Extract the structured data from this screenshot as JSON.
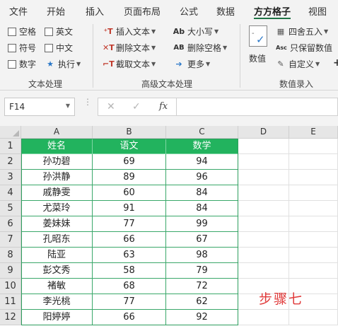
{
  "menu": {
    "tabs": [
      "文件",
      "开始",
      "插入",
      "页面布局",
      "公式",
      "数据",
      "方方格子",
      "视图"
    ],
    "active_index": 6
  },
  "ribbon": {
    "text_group": {
      "label": "文本处理",
      "checkboxes": [
        "空格",
        "英文",
        "符号",
        "中文",
        "数字"
      ],
      "execute_label": "执行"
    },
    "advanced_group": {
      "label": "高级文本处理",
      "insert_text": "插入文本",
      "delete_text": "删除文本",
      "extract_text": "截取文本",
      "case_label": "大小写",
      "case_icon_text": "Ab",
      "delete_spaces": "删除空格",
      "delete_spaces_icon_text": "AB",
      "more_label": "更多"
    },
    "number_group": {
      "label": "数值录入",
      "value_button": "数值",
      "round_label": "四舍五入",
      "keep_value_label": "只保留数值",
      "keep_value_icon_text": "Asc",
      "custom_label": "自定义"
    }
  },
  "formula_bar": {
    "name_box": "F14",
    "fx_label": "fx",
    "cancel_glyph": "✕",
    "confirm_glyph": "✓",
    "formula": ""
  },
  "sheet": {
    "columns": [
      "A",
      "B",
      "C",
      "D",
      "E"
    ],
    "rows": [
      "1",
      "2",
      "3",
      "4",
      "5",
      "6",
      "7",
      "8",
      "9",
      "10",
      "11",
      "12"
    ],
    "table_header": [
      "姓名",
      "语文",
      "数学"
    ],
    "table_rows": [
      [
        "孙功碧",
        "69",
        "94"
      ],
      [
        "孙洪静",
        "89",
        "96"
      ],
      [
        "戚静雯",
        "60",
        "84"
      ],
      [
        "尤菜玲",
        "91",
        "84"
      ],
      [
        "姜妹妹",
        "77",
        "99"
      ],
      [
        "孔昭东",
        "66",
        "67"
      ],
      [
        "陆亚",
        "63",
        "98"
      ],
      [
        "彭文秀",
        "58",
        "79"
      ],
      [
        "褚敏",
        "68",
        "72"
      ],
      [
        "李光桃",
        "77",
        "62"
      ],
      [
        "阳婷婷",
        "66",
        "92"
      ]
    ]
  },
  "annotation": "步骤七",
  "colors": {
    "header_fill": "#22b35e",
    "header_text": "#ffffff",
    "table_border": "#2e9e5e",
    "annotation": "#e03a3a",
    "active_tab_underline": "#217346"
  }
}
